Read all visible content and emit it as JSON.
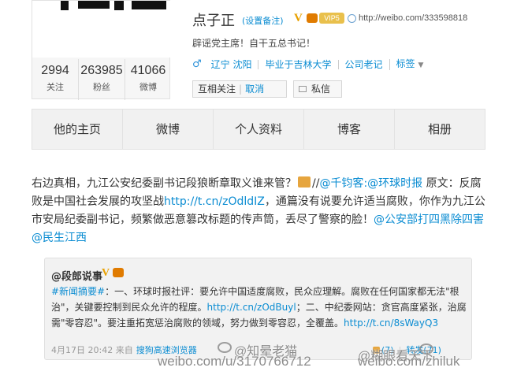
{
  "profile": {
    "name": "点子正",
    "remark_link": "(设置备注)",
    "verified_mark": "V",
    "vip_label": "VIP5",
    "url": "http://weibo.com/333598818",
    "bio": "辟谣党主席！自干五总书记！",
    "gender_icon": "male-icon",
    "info": [
      "辽宁 沈阳",
      "毕业于吉林大学",
      "公司老记",
      "标签"
    ],
    "follow_button": "互相关注",
    "follow_separator": "|",
    "unfollow_label": "取消",
    "message_button": "私信"
  },
  "stats": [
    {
      "value": "2994",
      "label": "关注"
    },
    {
      "value": "263985",
      "label": "粉丝"
    },
    {
      "value": "41066",
      "label": "微博"
    }
  ],
  "tabs": [
    "他的主页",
    "微博",
    "个人资料",
    "博客",
    "相册"
  ],
  "post": {
    "line1_a": "右边真相，九江公安纪委副书记段狼断章取义谁来管？",
    "line1_b": "//",
    "mention1": "@千钧客",
    "colon1": ":",
    "mention2": "@环球时报",
    "line1_c": " 原文：反腐败是中国社会发展的攻坚战",
    "link1": "http://t.cn/zOdldIZ",
    "line1_d": "，通篇没有说要允许适当腐败，你作为九江公市安局纪委副书记，频繁做恶意篡改标题的传声筒，丢尽了警察的脸！",
    "mention3": "@公安部打四黑除四害",
    "mention4": "@民生江西"
  },
  "retweet": {
    "author": "@段郎说事",
    "verified_mark": "V",
    "hashtag": "#新闻摘要#",
    "text_a": "：一、环球时报社评：要允许中国适度腐败，民众应理解。腐败在任何国家都无法\"根治\"，关键要控制到民众允许的程度。",
    "link1": "http://t.cn/zOdBuyl",
    "text_b": "；二、中纪委网站：贪官高度紧张，治腐需\"零容忍\"。要注重拓宽惩治腐败的领域，努力做到零容忍，全覆盖。",
    "link2": "http://t.cn/8sWayQ3",
    "time": "4月17日 20:42",
    "source_prefix": "来自",
    "source": "搜狗高速浏览器",
    "likes": "(7)",
    "repost": "转发(71)",
    "actions_sep": "|"
  },
  "watermarks": {
    "name1": "@知晕老猫",
    "url1": "weibo.com/u/3170766712",
    "name2": "@糊眼看天下",
    "url2": "weibo.com/zhiluk"
  }
}
